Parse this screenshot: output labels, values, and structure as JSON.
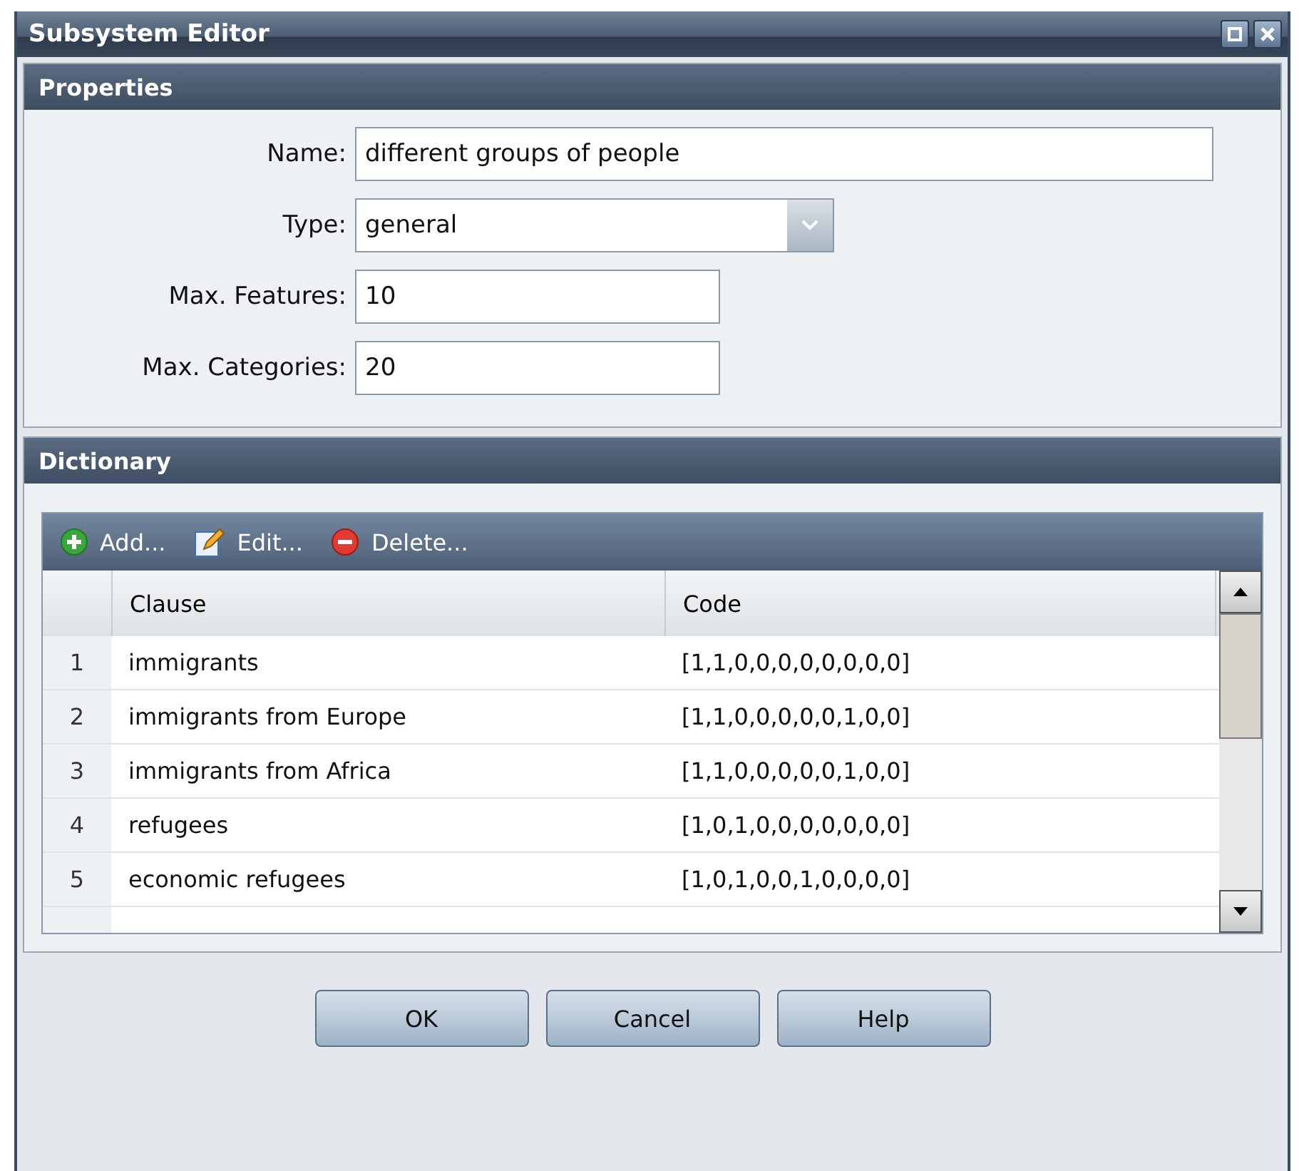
{
  "window": {
    "title": "Subsystem Editor"
  },
  "properties": {
    "title": "Properties",
    "fields": [
      {
        "label": "Name:",
        "value": "different groups of people",
        "kind": "text"
      },
      {
        "label": "Type:",
        "value": "general",
        "kind": "dropdown"
      },
      {
        "label": "Max. Features:",
        "value": "10",
        "kind": "text"
      },
      {
        "label": "Max. Categories:",
        "value": "20",
        "kind": "text"
      }
    ]
  },
  "dictionary": {
    "title": "Dictionary",
    "toolbar": [
      {
        "label": "Add...",
        "kind": "add"
      },
      {
        "label": "Edit...",
        "kind": "edit"
      },
      {
        "label": "Delete...",
        "kind": "delete"
      }
    ],
    "table": {
      "columns": [
        "Clause",
        "Code"
      ],
      "rows": [
        {
          "number": "1",
          "clause": "immigrants",
          "code": "[1,1,0,0,0,0,0,0,0,0]"
        },
        {
          "number": "2",
          "clause": "immigrants from Europe",
          "code": "[1,1,0,0,0,0,0,1,0,0]"
        },
        {
          "number": "3",
          "clause": "immigrants from Africa",
          "code": "[1,1,0,0,0,0,0,1,0,0]"
        },
        {
          "number": "4",
          "clause": "refugees",
          "code": "[1,0,1,0,0,0,0,0,0,0]"
        },
        {
          "number": "5",
          "clause": "economic refugees",
          "code": "[1,0,1,0,0,1,0,0,0,0]"
        }
      ]
    }
  },
  "buttons": [
    "OK",
    "Cancel",
    "Help"
  ]
}
